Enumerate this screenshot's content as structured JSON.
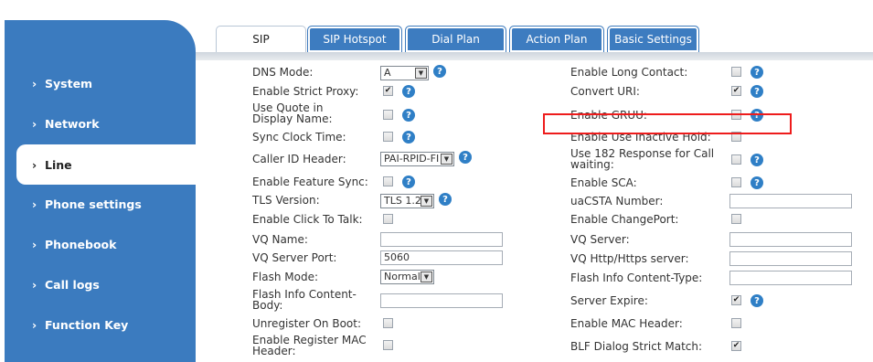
{
  "sidebar": {
    "items": [
      {
        "label": "System",
        "active": false
      },
      {
        "label": "Network",
        "active": false
      },
      {
        "label": "Line",
        "active": true
      },
      {
        "label": "Phone settings",
        "active": false
      },
      {
        "label": "Phonebook",
        "active": false
      },
      {
        "label": "Call logs",
        "active": false
      },
      {
        "label": "Function Key",
        "active": false
      }
    ],
    "chevron": "›"
  },
  "tabs": [
    {
      "label": "SIP",
      "selected": true
    },
    {
      "label": "SIP Hotspot",
      "selected": false
    },
    {
      "label": "Dial Plan",
      "selected": false
    },
    {
      "label": "Action Plan",
      "selected": false
    },
    {
      "label": "Basic Settings",
      "selected": false
    }
  ],
  "form": {
    "left": {
      "dns_mode": {
        "label": "DNS Mode:",
        "value": "A"
      },
      "strict_proxy": {
        "label": "Enable Strict Proxy:",
        "checked": true
      },
      "quote_display": {
        "label": "Use Quote in Display Name:",
        "checked": false
      },
      "sync_clock": {
        "label": "Sync Clock Time:",
        "checked": false
      },
      "caller_id": {
        "label": "Caller ID Header:",
        "value": "PAI-RPID-FI"
      },
      "feature_sync": {
        "label": "Enable Feature Sync:",
        "checked": false
      },
      "tls_version": {
        "label": "TLS Version:",
        "value": "TLS 1.2"
      },
      "click_to_talk": {
        "label": "Enable Click To Talk:",
        "checked": false
      },
      "vq_name": {
        "label": "VQ Name:",
        "value": ""
      },
      "vq_port": {
        "label": "VQ Server Port:",
        "value": "5060"
      },
      "flash_mode": {
        "label": "Flash Mode:",
        "value": "Normal"
      },
      "flash_body": {
        "label": "Flash Info Content-Body:",
        "value": ""
      },
      "unregister_boot": {
        "label": "Unregister On Boot:",
        "checked": false
      },
      "register_mac": {
        "label": "Enable Register MAC Header:",
        "checked": false
      }
    },
    "right": {
      "long_contact": {
        "label": "Enable Long Contact:",
        "checked": false
      },
      "convert_uri": {
        "label": "Convert URI:",
        "checked": true
      },
      "gruu": {
        "label": "Enable GRUU:",
        "checked": false
      },
      "inactive_hold": {
        "label": "Enable Use Inactive Hold:",
        "checked": false
      },
      "response_182": {
        "label": "Use 182 Response for Call waiting:",
        "checked": false
      },
      "sca": {
        "label": "Enable SCA:",
        "checked": false
      },
      "uacsta": {
        "label": "uaCSTA Number:",
        "value": ""
      },
      "change_port": {
        "label": "Enable ChangePort:",
        "checked": false
      },
      "vq_server": {
        "label": "VQ Server:",
        "value": ""
      },
      "vq_http": {
        "label": "VQ Http/Https server:",
        "value": ""
      },
      "flash_type": {
        "label": "Flash Info Content-Type:",
        "value": ""
      },
      "server_expire": {
        "label": "Server Expire:",
        "checked": true
      },
      "mac_header": {
        "label": "Enable MAC Header:",
        "checked": false
      },
      "blf_match": {
        "label": "BLF Dialog Strict Match:",
        "checked": true
      }
    }
  },
  "icons": {
    "help": "?",
    "check": "✔",
    "dropdown": "▼"
  },
  "colors": {
    "sidebar": "#3b7bbf",
    "tab": "#3d7cc0",
    "help": "#2f7fc6",
    "highlight": "#ee1c1c"
  }
}
